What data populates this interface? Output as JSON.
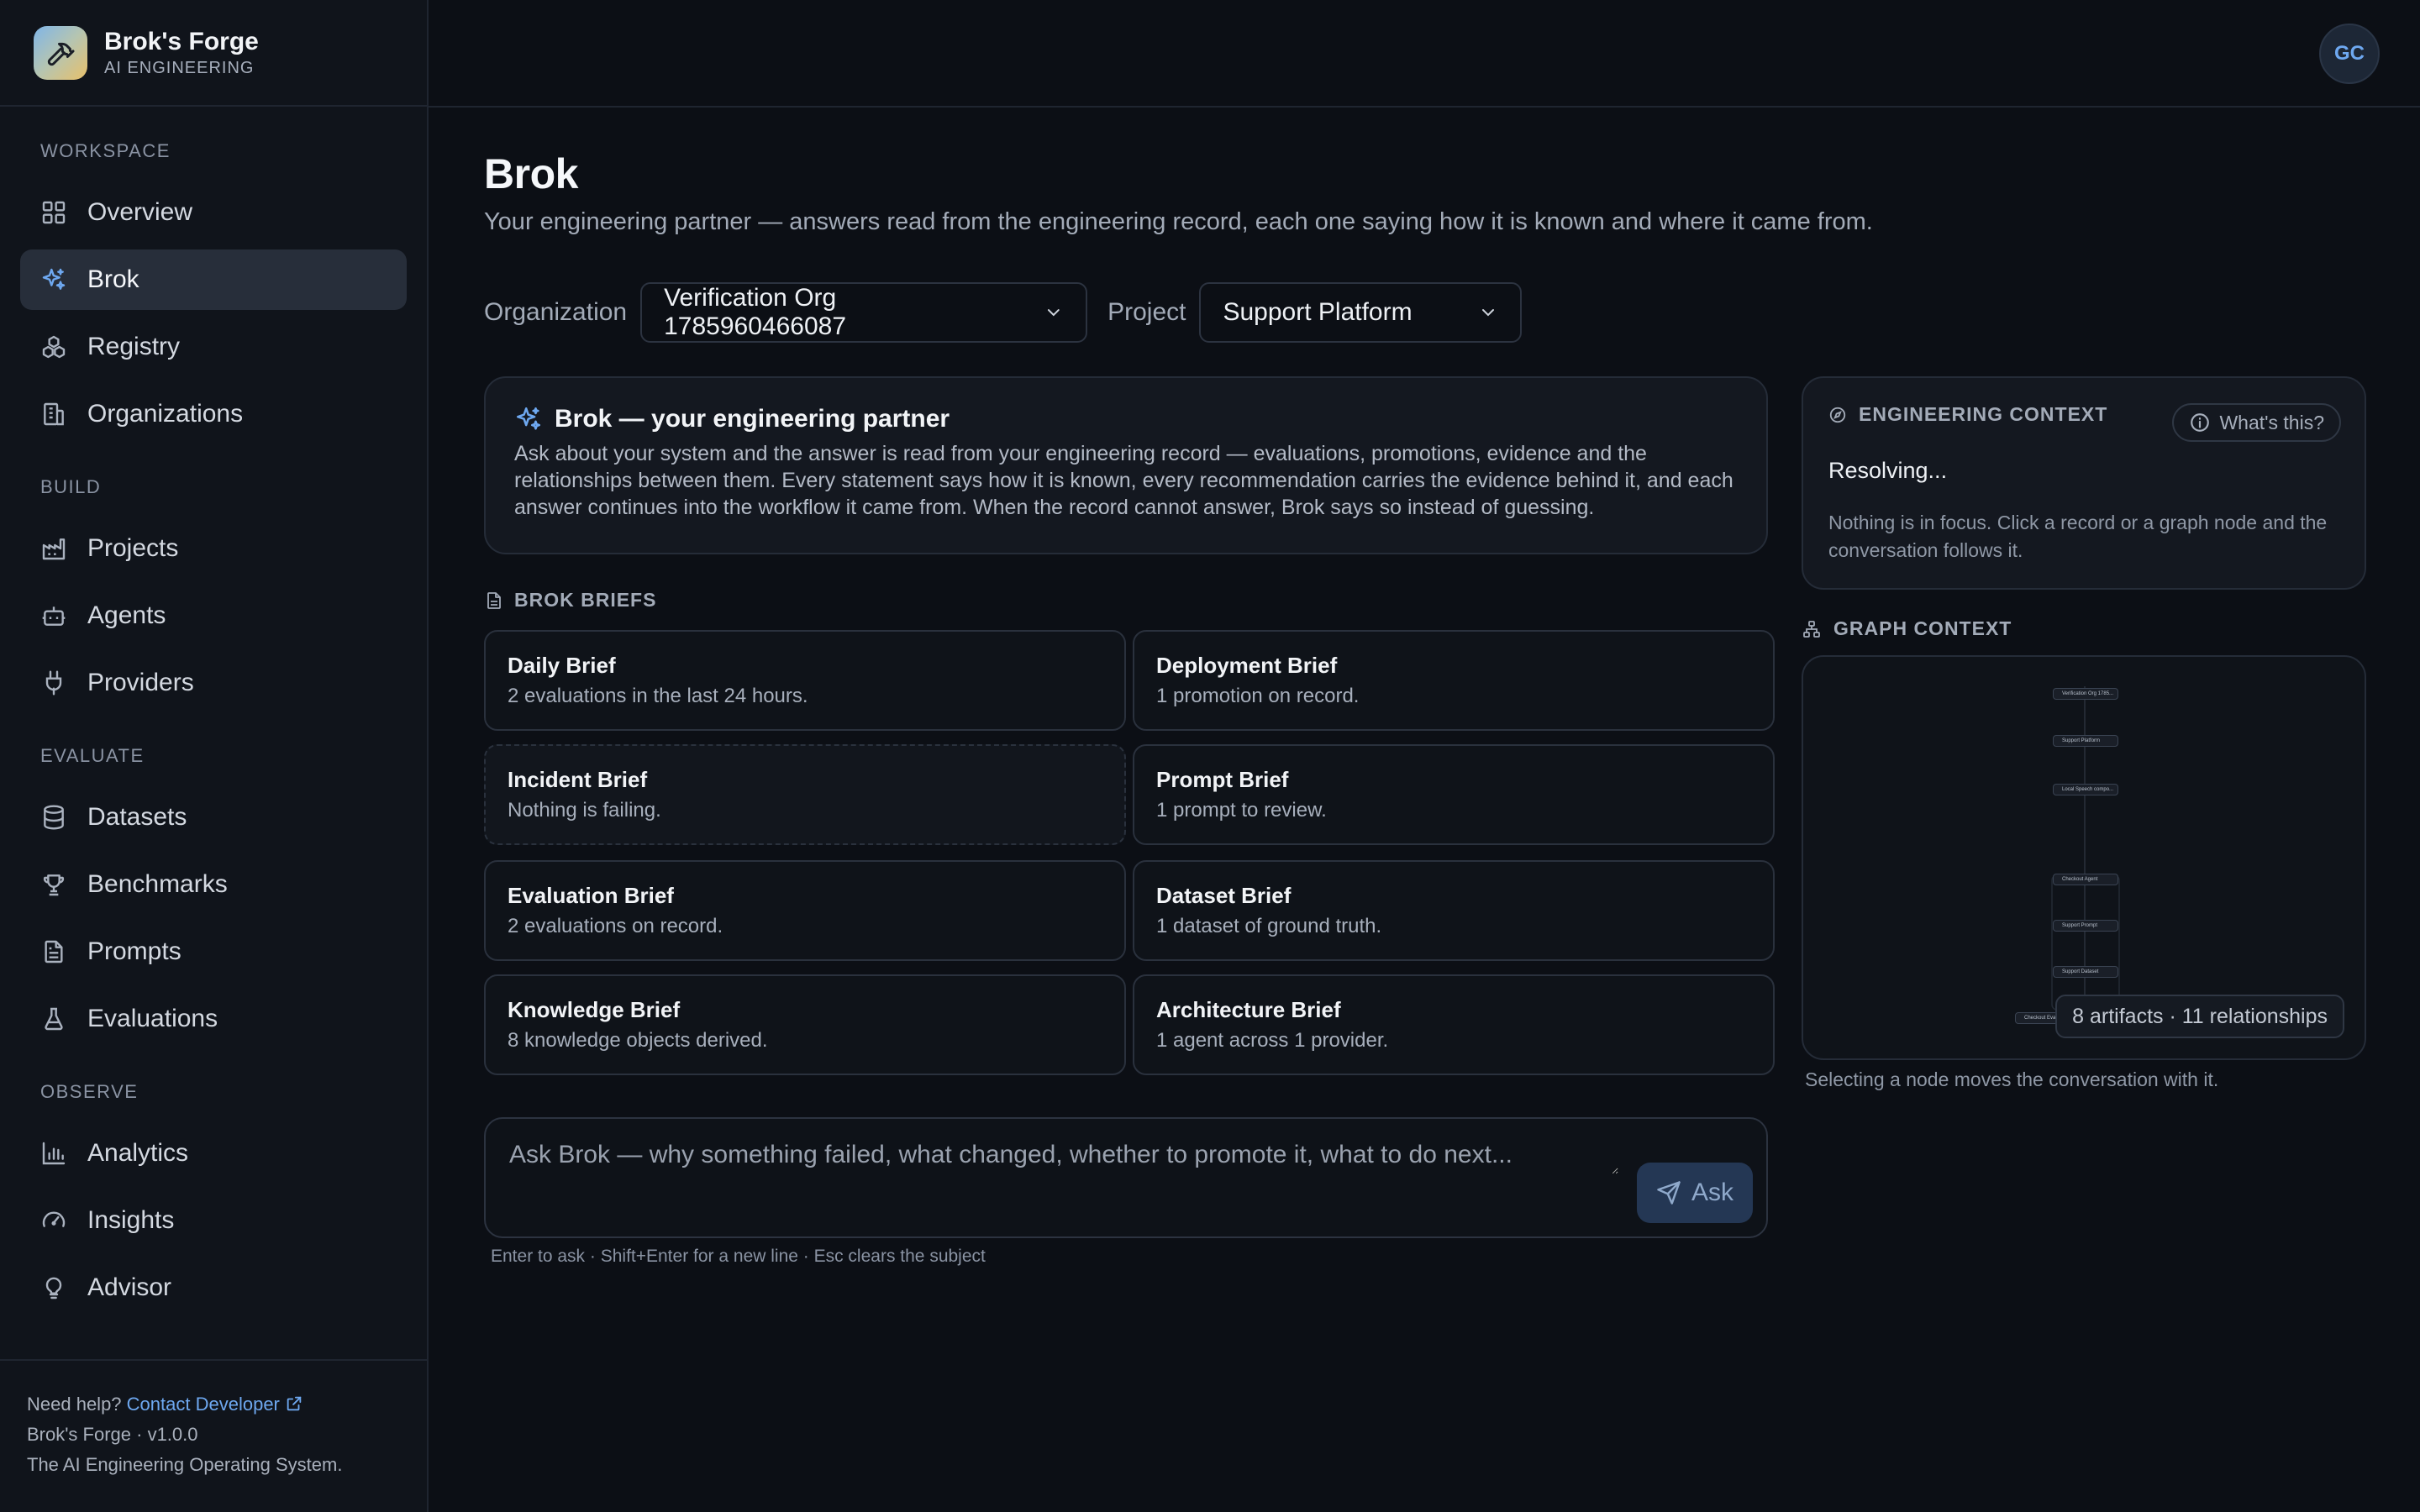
{
  "brand": {
    "name": "Brok's Forge",
    "subtitle": "AI ENGINEERING"
  },
  "user": {
    "initials": "GC"
  },
  "nav": {
    "sections": [
      {
        "label": "WORKSPACE",
        "items": [
          {
            "label": "Overview",
            "icon": "grid-icon"
          },
          {
            "label": "Brok",
            "icon": "sparkles-icon",
            "active": true
          },
          {
            "label": "Registry",
            "icon": "boxes-icon"
          },
          {
            "label": "Organizations",
            "icon": "building-icon"
          }
        ]
      },
      {
        "label": "BUILD",
        "items": [
          {
            "label": "Projects",
            "icon": "factory-icon"
          },
          {
            "label": "Agents",
            "icon": "bot-icon"
          },
          {
            "label": "Providers",
            "icon": "plug-icon"
          }
        ]
      },
      {
        "label": "EVALUATE",
        "items": [
          {
            "label": "Datasets",
            "icon": "database-icon"
          },
          {
            "label": "Benchmarks",
            "icon": "trophy-icon"
          },
          {
            "label": "Prompts",
            "icon": "file-text-icon"
          },
          {
            "label": "Evaluations",
            "icon": "flask-icon"
          }
        ]
      },
      {
        "label": "OBSERVE",
        "items": [
          {
            "label": "Analytics",
            "icon": "bar-chart-icon"
          },
          {
            "label": "Insights",
            "icon": "gauge-icon"
          },
          {
            "label": "Advisor",
            "icon": "lightbulb-icon"
          }
        ]
      }
    ]
  },
  "footer": {
    "help_prefix": "Need help?",
    "help_link": "Contact Developer",
    "version": "Brok's Forge · v1.0.0",
    "tagline": "The AI Engineering Operating System."
  },
  "page": {
    "title": "Brok",
    "subtitle": "Your engineering partner — answers read from the engineering record, each one saying how it is known and where it came from."
  },
  "selectors": {
    "org_label": "Organization",
    "org_value": "Verification Org 1785960466087",
    "project_label": "Project",
    "project_value": "Support Platform"
  },
  "intro": {
    "title": "Brok — your engineering partner",
    "body": "Ask about your system and the answer is read from your engineering record — evaluations, promotions, evidence and the relationships between them. Every statement says how it is known, every recommendation carries the evidence behind it, and each answer continues into the workflow it came from. When the record cannot answer, Brok says so instead of guessing."
  },
  "briefs": {
    "heading": "BROK BRIEFS",
    "items": [
      {
        "title": "Daily Brief",
        "sub": "2 evaluations in the last 24 hours."
      },
      {
        "title": "Deployment Brief",
        "sub": "1 promotion on record."
      },
      {
        "title": "Incident Brief",
        "sub": "Nothing is failing."
      },
      {
        "title": "Prompt Brief",
        "sub": "1 prompt to review."
      },
      {
        "title": "Evaluation Brief",
        "sub": "2 evaluations on record."
      },
      {
        "title": "Dataset Brief",
        "sub": "1 dataset of ground truth."
      },
      {
        "title": "Knowledge Brief",
        "sub": "8 knowledge objects derived."
      },
      {
        "title": "Architecture Brief",
        "sub": "1 agent across 1 provider."
      }
    ]
  },
  "ask": {
    "placeholder": "Ask Brok — why something failed, what changed, whether to promote it, what to do next...",
    "button": "Ask",
    "hint": "Enter to ask · Shift+Enter for a new line · Esc clears the subject"
  },
  "context": {
    "heading": "ENGINEERING CONTEXT",
    "whats_this": "What's this?",
    "status": "Resolving...",
    "note": "Nothing is in focus. Click a record or a graph node and the conversation follows it."
  },
  "graph": {
    "heading": "GRAPH CONTEXT",
    "badge": "8 artifacts · 11 relationships",
    "note": "Selecting a node moves the conversation with it.",
    "nodes": [
      "Verification Org 1785...",
      "Support Platform",
      "Local Speech compo...",
      "Checkout Agent",
      "Support Prompt",
      "Support Dataset",
      "Checkout Eval"
    ]
  },
  "colors": {
    "accent": "#6ea8f0",
    "active_bg": "#272e3a",
    "background": "#0c0f15"
  }
}
